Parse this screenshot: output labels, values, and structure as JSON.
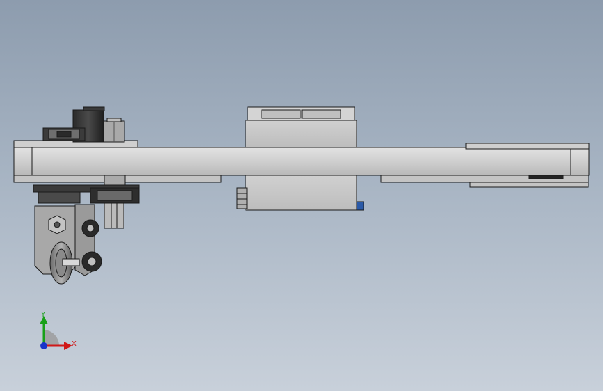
{
  "scene": {
    "background_top": "#8d9cae",
    "background_bottom": "#c8d0da",
    "part_color": "#c9c9c9",
    "edge_color": "#1a1a1a"
  },
  "triad": {
    "x_label": "X",
    "y_label": "Y",
    "x_color": "#d01818",
    "y_color": "#18a018",
    "z_color": "#1a34c8"
  }
}
